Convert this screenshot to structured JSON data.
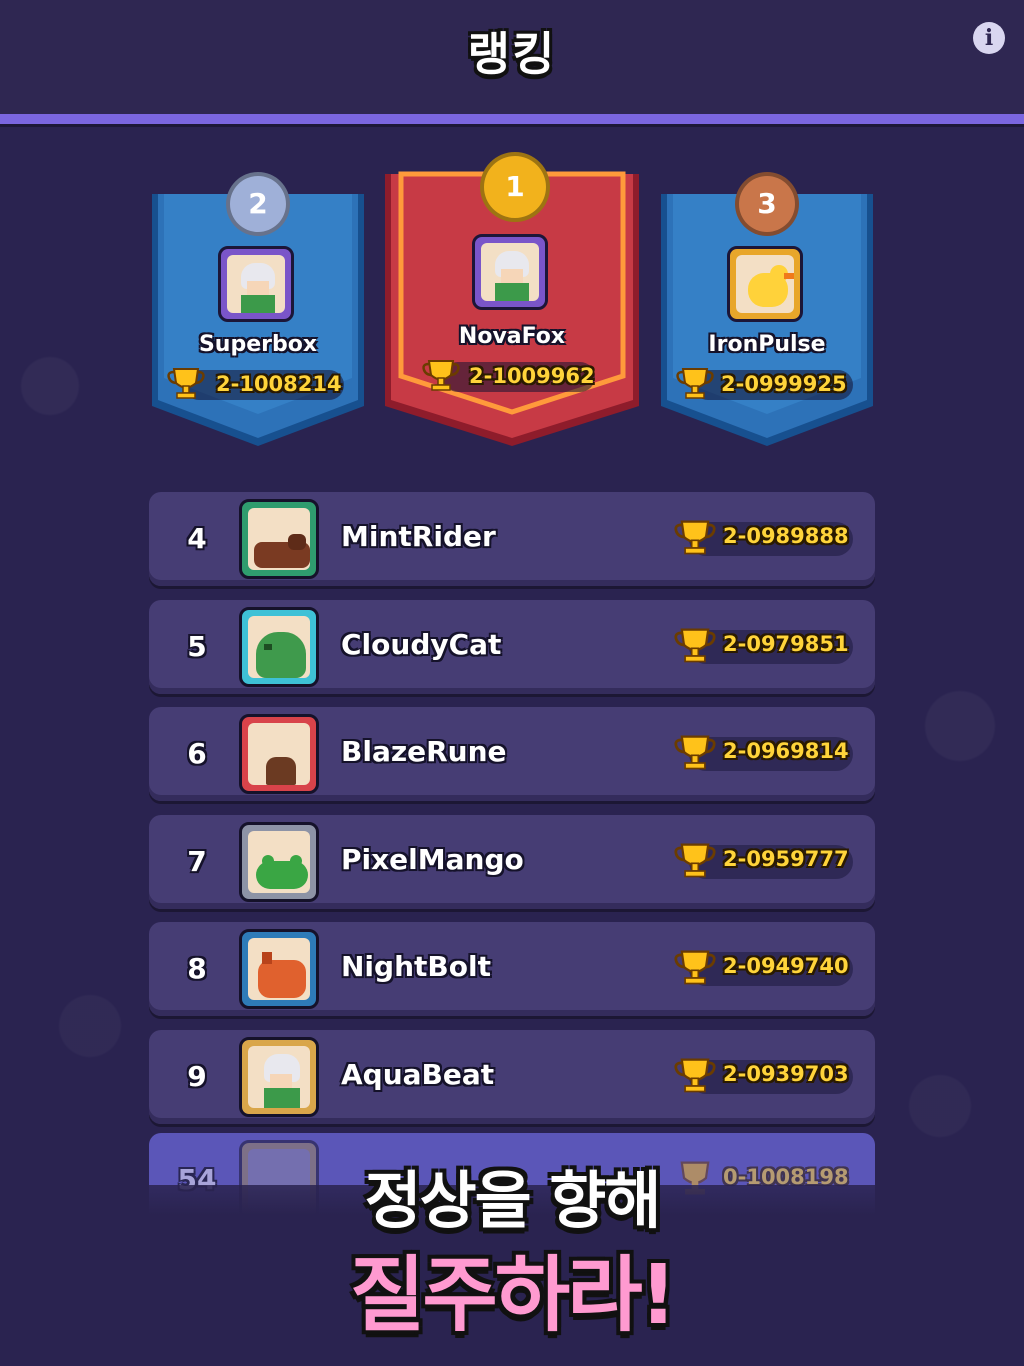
{
  "header": {
    "title": "랭킹",
    "info_icon": "info-icon"
  },
  "podium": [
    {
      "place": "2",
      "name": "Superbox",
      "score": "2-1008214",
      "medal": "silver-medal-icon",
      "avatar": "white-haired-archer-avatar"
    },
    {
      "place": "1",
      "name": "NovaFox",
      "score": "2-1009962",
      "medal": "gold-medal-icon",
      "avatar": "white-haired-archer-avatar"
    },
    {
      "place": "3",
      "name": "IronPulse",
      "score": "2-0999925",
      "medal": "bronze-medal-icon",
      "avatar": "yellow-chick-avatar"
    }
  ],
  "rows": [
    {
      "rank": "4",
      "name": "MintRider",
      "score": "2-0989888",
      "avatar": "brown-bear-avatar"
    },
    {
      "rank": "5",
      "name": "CloudyCat",
      "score": "2-0979851",
      "avatar": "green-slime-avatar"
    },
    {
      "rank": "6",
      "name": "BlazeRune",
      "score": "2-0969814",
      "avatar": "tree-stump-avatar"
    },
    {
      "rank": "7",
      "name": "PixelMango",
      "score": "2-0959777",
      "avatar": "green-frog-avatar"
    },
    {
      "rank": "8",
      "name": "NightBolt",
      "score": "2-0949740",
      "avatar": "orange-boar-avatar"
    },
    {
      "rank": "9",
      "name": "AquaBeat",
      "score": "2-0939703",
      "avatar": "white-haired-archer-avatar"
    }
  ],
  "my_row": {
    "rank": "54",
    "score": "0-1008198"
  },
  "promo": {
    "line1": "정상을 향해",
    "line2": "질주하라!"
  },
  "colors": {
    "gold": "#ffd43a",
    "first_banner": "#c73a45",
    "side_banner": "#2d72b8",
    "header_line": "#7b66e0",
    "promo_pink": "#ff9ad0"
  }
}
